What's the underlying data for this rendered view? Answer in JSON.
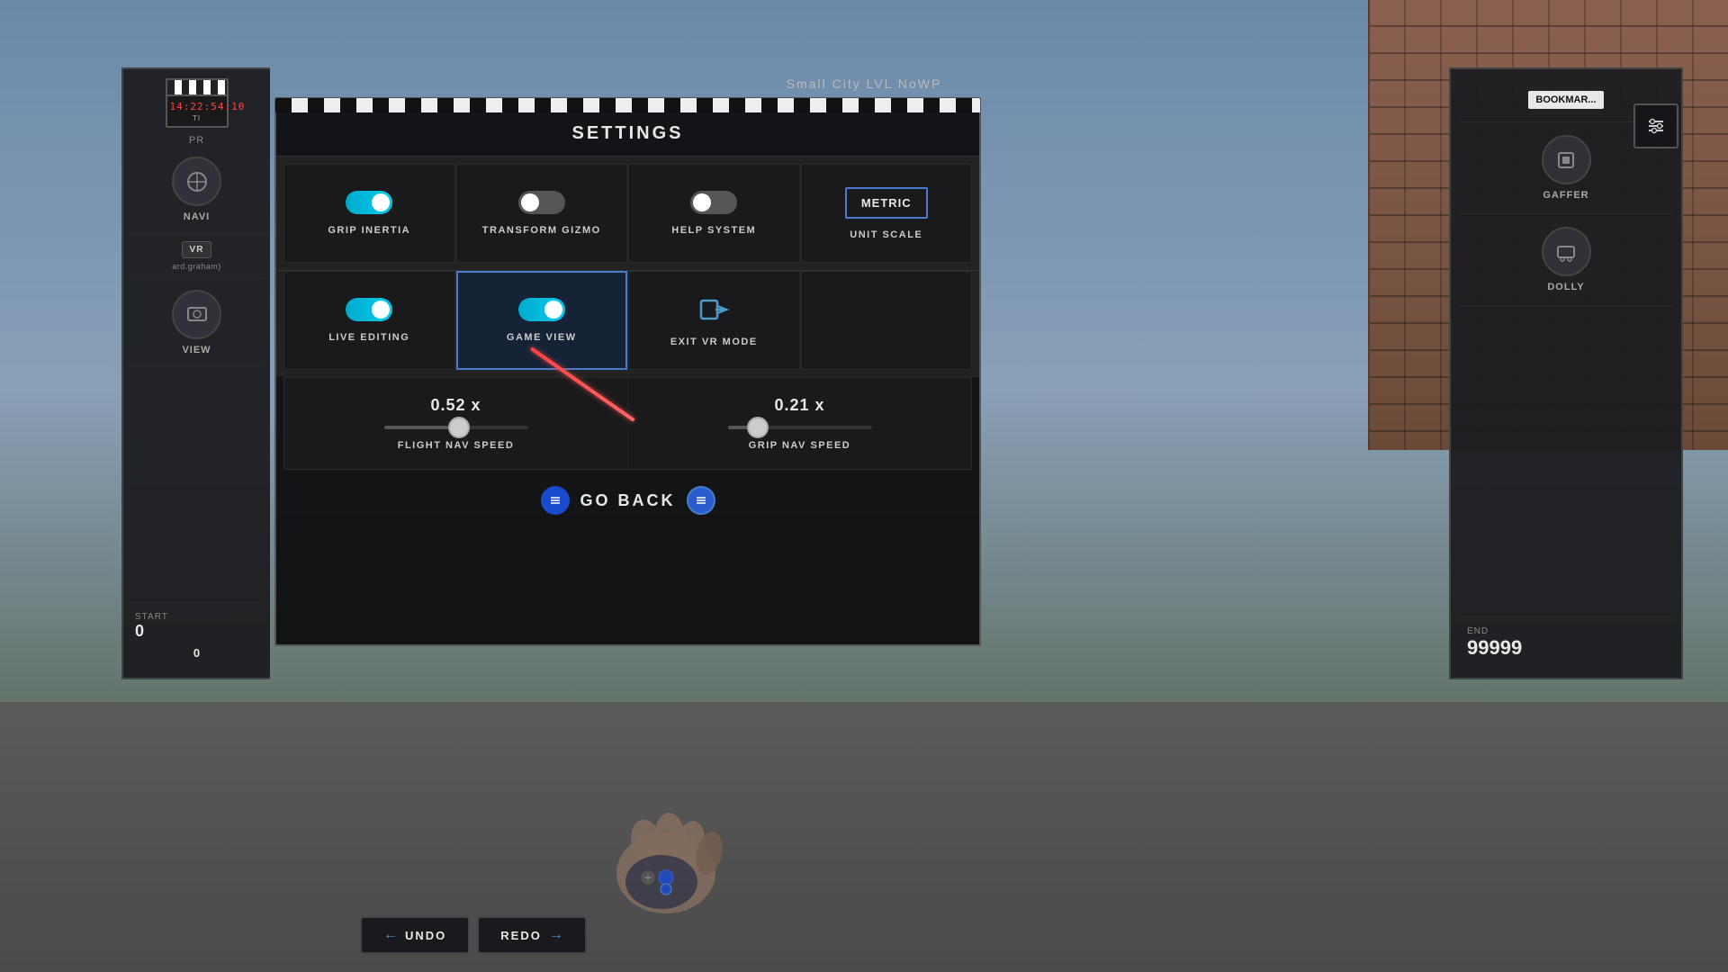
{
  "scene": {
    "title": "Small City LVL NoWP",
    "timecode": "14:22:54:10"
  },
  "settings": {
    "title": "SETTINGS",
    "grid_row1": [
      {
        "id": "grip_inertia",
        "label": "GRIP INERTIA",
        "type": "toggle",
        "state": "on",
        "highlighted": false
      },
      {
        "id": "transform_gizmo",
        "label": "TRANSFORM GIZMO",
        "type": "toggle",
        "state": "off",
        "highlighted": false
      },
      {
        "id": "help_system",
        "label": "HELP SYSTEM",
        "type": "toggle",
        "state": "off",
        "highlighted": false
      },
      {
        "id": "unit_scale",
        "label": "UNIT SCALE",
        "type": "button",
        "button_label": "METRIC",
        "highlighted": false
      }
    ],
    "grid_row2": [
      {
        "id": "live_editing",
        "label": "LIVE EDITING",
        "type": "toggle",
        "state": "on",
        "highlighted": false
      },
      {
        "id": "game_view",
        "label": "GAME VIEW",
        "type": "toggle",
        "state": "on",
        "highlighted": true
      },
      {
        "id": "exit_vr_mode",
        "label": "EXIT VR MODE",
        "type": "icon",
        "highlighted": false
      },
      {
        "id": "empty",
        "label": "",
        "type": "empty",
        "highlighted": false
      }
    ],
    "sliders": [
      {
        "id": "flight_nav_speed",
        "label": "FLIGHT NAV SPEED",
        "value": "0.52 x",
        "percent": 52
      },
      {
        "id": "grip_nav_speed",
        "label": "GRIP NAV SPEED",
        "value": "0.21 x",
        "percent": 21
      }
    ],
    "go_back_label": "GO BACK"
  },
  "left_panel": {
    "timecode": "14:22:54:10",
    "nav_items": [
      {
        "id": "navi",
        "label": "NAVI"
      },
      {
        "id": "view",
        "label": "VIEW"
      }
    ],
    "vr_badge": "VR",
    "user": "ard.graham)",
    "start_label": "START",
    "start_value": "0",
    "frame_value": "0",
    "pr_label": "PR"
  },
  "right_panel": {
    "nav_items": [
      {
        "id": "bookmark",
        "label": "BOOKMAR..."
      },
      {
        "id": "gaffer",
        "label": "GAFFER"
      },
      {
        "id": "dolly",
        "label": "DOLLY"
      }
    ],
    "end_label": "END",
    "end_value": "99999"
  },
  "bottom_toolbar": [
    {
      "id": "undo",
      "label": "UNDO",
      "icon": "←"
    },
    {
      "id": "redo",
      "label": "REDO",
      "icon": "→"
    }
  ],
  "settings_gear_icon": "⊟"
}
